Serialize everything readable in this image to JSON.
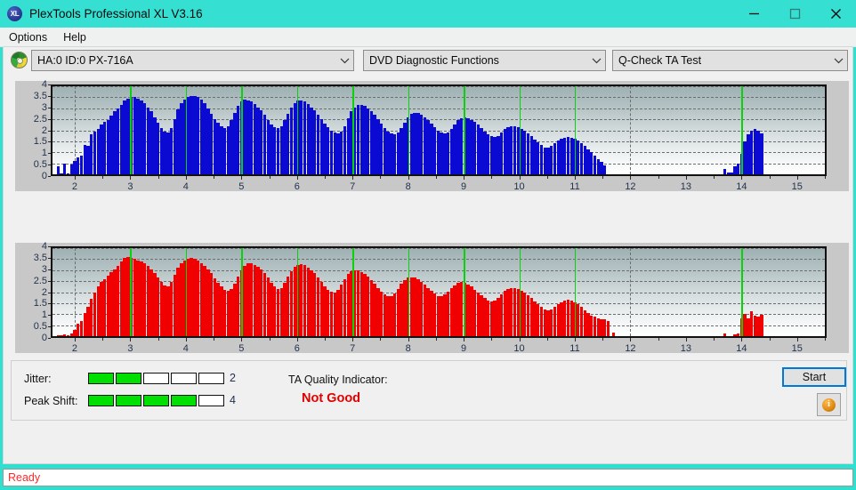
{
  "window": {
    "title": "PlexTools Professional XL V3.16",
    "icon_label": "XL",
    "minimize_icon": "minimize-icon",
    "maximize_icon": "maximize-icon",
    "close_icon": "close-icon"
  },
  "menubar": {
    "items": [
      {
        "label": "Options"
      },
      {
        "label": "Help"
      }
    ]
  },
  "toolbar": {
    "drive_icon": "disc-icon",
    "drive_combo": {
      "value": "HA:0 ID:0  PX-716A"
    },
    "function_combo": {
      "value": "DVD Diagnostic Functions"
    },
    "test_combo": {
      "value": "Q-Check TA Test"
    }
  },
  "results": {
    "jitter_label": "Jitter:",
    "jitter_value": "2",
    "jitter_filled": 2,
    "jitter_total": 5,
    "peak_shift_label": "Peak Shift:",
    "peak_shift_value": "4",
    "peak_shift_filled": 4,
    "peak_shift_total": 5,
    "ta_quality_label": "TA Quality Indicator:",
    "ta_quality_value": "Not Good",
    "ta_quality_color": "#e00000",
    "start_label": "Start",
    "info_label": "i"
  },
  "statusbar": {
    "text": "Ready",
    "color": "#ff2a2a"
  },
  "chart_data": [
    {
      "id": "jitter-chart",
      "type": "bar",
      "title": "",
      "xlabel": "",
      "ylabel": "",
      "color": "#0a0ad2",
      "xlim": [
        1.6,
        15.5
      ],
      "ylim": [
        0,
        4
      ],
      "yticks": [
        0,
        0.5,
        1,
        1.5,
        2,
        2.5,
        3,
        3.5,
        4
      ],
      "ytick_labels": [
        "0",
        "0.5",
        "1",
        "1.5",
        "2",
        "2.5",
        "3",
        "3.5",
        "4"
      ],
      "xticks": [
        2,
        3,
        4,
        5,
        6,
        7,
        8,
        9,
        10,
        11,
        12,
        13,
        14,
        15
      ],
      "xtick_labels": [
        "2",
        "3",
        "4",
        "5",
        "6",
        "7",
        "8",
        "9",
        "10",
        "11",
        "12",
        "13",
        "14",
        "15"
      ],
      "minor_xticks": [
        2.25,
        2.5,
        2.75,
        3.25,
        3.5,
        3.75,
        4.25,
        4.5,
        4.75,
        5.25,
        5.5,
        5.75,
        6.25,
        6.5,
        6.75,
        7.25,
        7.5,
        7.75,
        8.25,
        8.5,
        8.75,
        9.25,
        9.5,
        9.75,
        10.25,
        10.5,
        10.75,
        11.25,
        11.5,
        11.75,
        12.25,
        12.5,
        12.75,
        13.25,
        13.5,
        13.75,
        14.25,
        14.5,
        14.75,
        15.25
      ],
      "grid_major_x": [
        2,
        4,
        6,
        8,
        10,
        12,
        14
      ],
      "markers_x": [
        3,
        4,
        5,
        6,
        7,
        8,
        9,
        10,
        11,
        14
      ],
      "grid": true,
      "legend": "none",
      "x": [
        1.7,
        1.76,
        1.82,
        1.88,
        1.94,
        2.0,
        2.06,
        2.12,
        2.18,
        2.24,
        2.3,
        2.36,
        2.42,
        2.48,
        2.54,
        2.6,
        2.66,
        2.72,
        2.78,
        2.84,
        2.9,
        2.96,
        3.02,
        3.08,
        3.14,
        3.2,
        3.26,
        3.32,
        3.38,
        3.44,
        3.5,
        3.56,
        3.62,
        3.68,
        3.74,
        3.8,
        3.86,
        3.92,
        3.98,
        4.04,
        4.1,
        4.16,
        4.22,
        4.28,
        4.34,
        4.4,
        4.46,
        4.52,
        4.58,
        4.64,
        4.7,
        4.76,
        4.82,
        4.88,
        4.94,
        5.0,
        5.06,
        5.12,
        5.18,
        5.24,
        5.3,
        5.36,
        5.42,
        5.48,
        5.54,
        5.6,
        5.66,
        5.72,
        5.78,
        5.84,
        5.9,
        5.96,
        6.02,
        6.08,
        6.14,
        6.2,
        6.26,
        6.32,
        6.38,
        6.44,
        6.5,
        6.56,
        6.62,
        6.68,
        6.74,
        6.8,
        6.86,
        6.92,
        6.98,
        7.04,
        7.1,
        7.16,
        7.22,
        7.28,
        7.34,
        7.4,
        7.46,
        7.52,
        7.58,
        7.64,
        7.7,
        7.76,
        7.82,
        7.88,
        7.94,
        8.0,
        8.06,
        8.12,
        8.18,
        8.24,
        8.3,
        8.36,
        8.42,
        8.48,
        8.54,
        8.6,
        8.66,
        8.72,
        8.78,
        8.84,
        8.9,
        8.96,
        9.02,
        9.08,
        9.14,
        9.2,
        9.26,
        9.32,
        9.38,
        9.44,
        9.5,
        9.56,
        9.62,
        9.68,
        9.74,
        9.8,
        9.86,
        9.92,
        9.98,
        10.04,
        10.1,
        10.16,
        10.22,
        10.28,
        10.34,
        10.4,
        10.46,
        10.52,
        10.58,
        10.64,
        10.7,
        10.76,
        10.82,
        10.88,
        10.94,
        11.0,
        11.06,
        11.12,
        11.18,
        11.24,
        11.3,
        11.36,
        11.42,
        11.48,
        11.54,
        13.7,
        13.76,
        13.82,
        13.88,
        13.94,
        14.0,
        14.06,
        14.12,
        14.18,
        14.24,
        14.3,
        14.36
      ],
      "values": [
        0.35,
        0.05,
        0.5,
        0.04,
        0.45,
        0.6,
        0.75,
        0.85,
        1.35,
        1.3,
        1.8,
        1.95,
        2.05,
        2.25,
        2.4,
        2.45,
        2.65,
        2.85,
        3.0,
        3.15,
        3.35,
        3.45,
        3.5,
        3.5,
        3.45,
        3.35,
        3.25,
        3.05,
        2.85,
        2.6,
        2.35,
        2.1,
        1.95,
        1.9,
        2.1,
        2.5,
        2.95,
        3.25,
        3.4,
        3.5,
        3.55,
        3.55,
        3.5,
        3.4,
        3.25,
        3.0,
        2.75,
        2.5,
        2.35,
        2.2,
        2.1,
        2.2,
        2.45,
        2.8,
        3.1,
        3.3,
        3.4,
        3.35,
        3.3,
        3.2,
        3.05,
        2.9,
        2.7,
        2.45,
        2.25,
        2.15,
        2.1,
        2.2,
        2.45,
        2.75,
        3.05,
        3.25,
        3.35,
        3.35,
        3.3,
        3.2,
        3.05,
        2.9,
        2.7,
        2.5,
        2.3,
        2.15,
        2.0,
        1.9,
        1.85,
        1.95,
        2.2,
        2.55,
        2.85,
        3.05,
        3.15,
        3.15,
        3.1,
        3.0,
        2.85,
        2.7,
        2.5,
        2.3,
        2.1,
        1.95,
        1.85,
        1.8,
        1.9,
        2.1,
        2.35,
        2.6,
        2.75,
        2.8,
        2.78,
        2.7,
        2.6,
        2.45,
        2.3,
        2.15,
        2.0,
        1.9,
        1.85,
        1.9,
        2.05,
        2.25,
        2.45,
        2.55,
        2.58,
        2.55,
        2.48,
        2.38,
        2.25,
        2.1,
        1.95,
        1.82,
        1.72,
        1.68,
        1.75,
        1.9,
        2.05,
        2.15,
        2.2,
        2.2,
        2.15,
        2.08,
        1.98,
        1.85,
        1.72,
        1.58,
        1.45,
        1.32,
        1.22,
        1.2,
        1.3,
        1.42,
        1.55,
        1.62,
        1.65,
        1.68,
        1.65,
        1.6,
        1.52,
        1.42,
        1.3,
        1.15,
        1.0,
        0.85,
        0.7,
        0.55,
        0.4,
        0.26,
        0.1,
        0.08,
        0.35,
        0.5,
        0.95,
        1.5,
        1.8,
        1.98,
        2.05,
        2.0,
        1.85,
        1.55,
        1.15,
        0.7,
        0.3
      ]
    },
    {
      "id": "peak-shift-chart",
      "type": "bar",
      "title": "",
      "xlabel": "",
      "ylabel": "",
      "color": "#f00000",
      "xlim": [
        1.6,
        15.5
      ],
      "ylim": [
        0,
        4
      ],
      "yticks": [
        0,
        0.5,
        1,
        1.5,
        2,
        2.5,
        3,
        3.5,
        4
      ],
      "ytick_labels": [
        "0",
        "0.5",
        "1",
        "1.5",
        "2",
        "2.5",
        "3",
        "3.5",
        "4"
      ],
      "xticks": [
        2,
        3,
        4,
        5,
        6,
        7,
        8,
        9,
        10,
        11,
        12,
        13,
        14,
        15
      ],
      "xtick_labels": [
        "2",
        "3",
        "4",
        "5",
        "6",
        "7",
        "8",
        "9",
        "10",
        "11",
        "12",
        "13",
        "14",
        "15"
      ],
      "grid_major_x": [
        2,
        4,
        6,
        8,
        10,
        12,
        14
      ],
      "markers_x": [
        3,
        4,
        5,
        6,
        7,
        8,
        9,
        10,
        11,
        14
      ],
      "grid": true,
      "legend": "none",
      "x": [
        1.7,
        1.76,
        1.82,
        1.88,
        1.94,
        2.0,
        2.06,
        2.12,
        2.18,
        2.24,
        2.3,
        2.36,
        2.42,
        2.48,
        2.54,
        2.6,
        2.66,
        2.72,
        2.78,
        2.84,
        2.9,
        2.96,
        3.02,
        3.08,
        3.14,
        3.2,
        3.26,
        3.32,
        3.38,
        3.44,
        3.5,
        3.56,
        3.62,
        3.68,
        3.74,
        3.8,
        3.86,
        3.92,
        3.98,
        4.04,
        4.1,
        4.16,
        4.22,
        4.28,
        4.34,
        4.4,
        4.46,
        4.52,
        4.58,
        4.64,
        4.7,
        4.76,
        4.82,
        4.88,
        4.94,
        5.0,
        5.06,
        5.12,
        5.18,
        5.24,
        5.3,
        5.36,
        5.42,
        5.48,
        5.54,
        5.6,
        5.66,
        5.72,
        5.78,
        5.84,
        5.9,
        5.96,
        6.02,
        6.08,
        6.14,
        6.2,
        6.26,
        6.32,
        6.38,
        6.44,
        6.5,
        6.56,
        6.62,
        6.68,
        6.74,
        6.8,
        6.86,
        6.92,
        6.98,
        7.04,
        7.1,
        7.16,
        7.22,
        7.28,
        7.34,
        7.4,
        7.46,
        7.52,
        7.58,
        7.64,
        7.7,
        7.76,
        7.82,
        7.88,
        7.94,
        8.0,
        8.06,
        8.12,
        8.18,
        8.24,
        8.3,
        8.36,
        8.42,
        8.48,
        8.54,
        8.6,
        8.66,
        8.72,
        8.78,
        8.84,
        8.9,
        8.96,
        9.02,
        9.08,
        9.14,
        9.2,
        9.26,
        9.32,
        9.38,
        9.44,
        9.5,
        9.56,
        9.62,
        9.68,
        9.74,
        9.8,
        9.86,
        9.92,
        9.98,
        10.04,
        10.1,
        10.16,
        10.22,
        10.28,
        10.34,
        10.4,
        10.46,
        10.52,
        10.58,
        10.64,
        10.7,
        10.76,
        10.82,
        10.88,
        10.94,
        11.0,
        11.06,
        11.12,
        11.18,
        11.24,
        11.3,
        11.36,
        11.42,
        11.48,
        11.54,
        11.6,
        11.7,
        13.7,
        13.88,
        13.94,
        14.0,
        14.06,
        14.12,
        14.18,
        14.24,
        14.3,
        14.36
      ],
      "values": [
        0.02,
        0.02,
        0.1,
        0.03,
        0.12,
        0.3,
        0.55,
        0.7,
        1.05,
        1.35,
        1.7,
        2.0,
        2.25,
        2.45,
        2.6,
        2.75,
        2.9,
        3.05,
        3.2,
        3.4,
        3.55,
        3.58,
        3.55,
        3.5,
        3.45,
        3.38,
        3.3,
        3.2,
        3.05,
        2.85,
        2.65,
        2.45,
        2.32,
        2.28,
        2.45,
        2.8,
        3.1,
        3.3,
        3.45,
        3.52,
        3.55,
        3.5,
        3.42,
        3.32,
        3.2,
        3.05,
        2.85,
        2.62,
        2.42,
        2.25,
        2.12,
        2.05,
        2.15,
        2.4,
        2.7,
        3.0,
        3.2,
        3.3,
        3.3,
        3.25,
        3.15,
        3.02,
        2.85,
        2.65,
        2.42,
        2.25,
        2.15,
        2.2,
        2.42,
        2.7,
        2.95,
        3.15,
        3.25,
        3.28,
        3.22,
        3.12,
        3.0,
        2.85,
        2.68,
        2.48,
        2.28,
        2.12,
        2.02,
        2.0,
        2.12,
        2.35,
        2.6,
        2.82,
        2.95,
        3.0,
        2.98,
        2.92,
        2.82,
        2.7,
        2.55,
        2.38,
        2.2,
        2.02,
        1.88,
        1.8,
        1.82,
        1.95,
        2.15,
        2.38,
        2.55,
        2.65,
        2.68,
        2.65,
        2.58,
        2.48,
        2.35,
        2.2,
        2.05,
        1.92,
        1.82,
        1.8,
        1.88,
        2.02,
        2.18,
        2.32,
        2.42,
        2.45,
        2.42,
        2.35,
        2.25,
        2.12,
        1.98,
        1.85,
        1.72,
        1.62,
        1.58,
        1.62,
        1.75,
        1.9,
        2.05,
        2.15,
        2.2,
        2.2,
        2.15,
        2.08,
        1.98,
        1.86,
        1.72,
        1.58,
        1.45,
        1.32,
        1.22,
        1.18,
        1.22,
        1.32,
        1.45,
        1.55,
        1.62,
        1.65,
        1.62,
        1.55,
        1.45,
        1.32,
        1.18,
        1.05,
        0.95,
        0.88,
        0.82,
        0.78,
        0.75,
        0.7,
        0.15,
        0.12,
        0.08,
        0.12,
        0.8,
        1.0,
        0.82,
        1.12,
        0.92,
        0.88,
        0.98,
        0.3
      ]
    }
  ]
}
